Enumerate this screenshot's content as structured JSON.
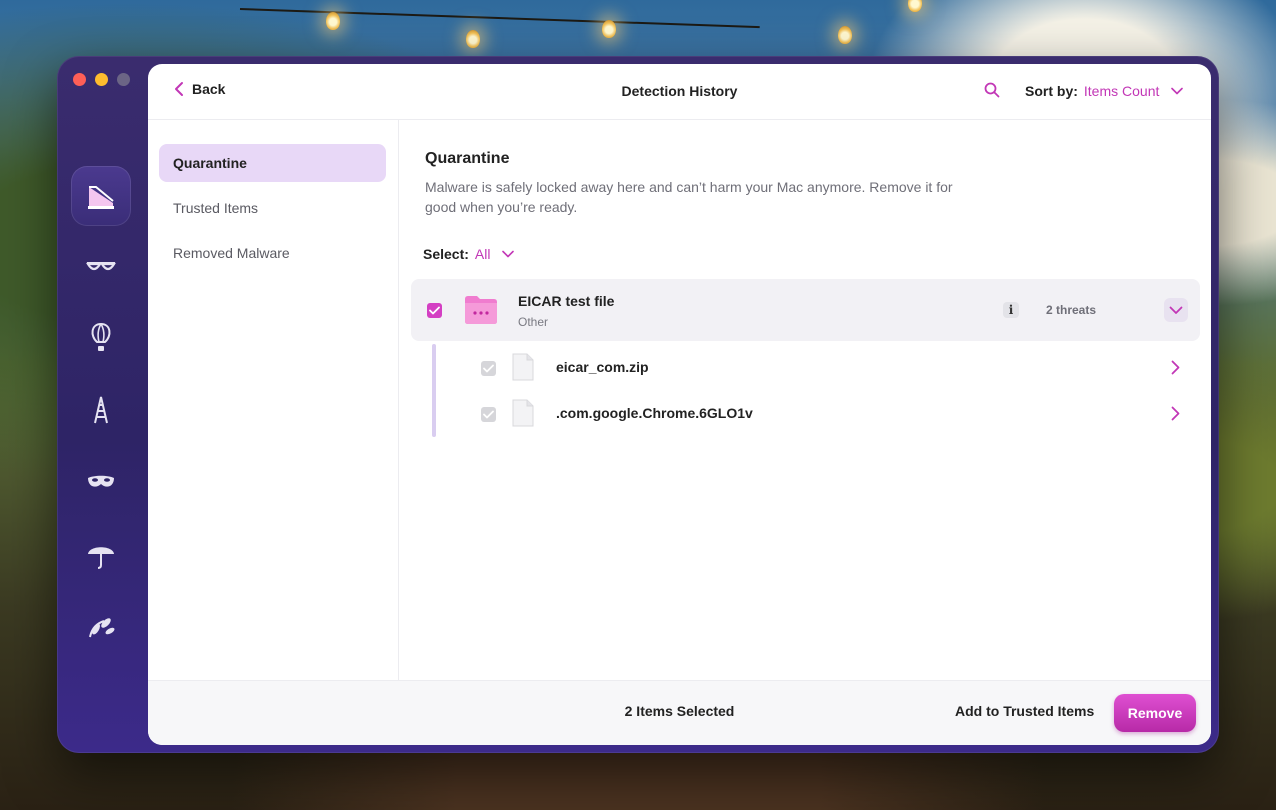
{
  "header": {
    "back_label": "Back",
    "title": "Detection History",
    "sort_label": "Sort by:",
    "sort_value": "Items Count"
  },
  "nav": {
    "items": [
      {
        "label": "Quarantine",
        "active": true
      },
      {
        "label": "Trusted Items",
        "active": false
      },
      {
        "label": "Removed Malware",
        "active": false
      }
    ]
  },
  "sidebar_icons": [
    "cleanup-icon",
    "glasses-icon",
    "balloon-icon",
    "ladder-icon",
    "mask-icon",
    "umbrella-icon",
    "leaves-icon"
  ],
  "content": {
    "heading": "Quarantine",
    "description": "Malware is safely locked away here and can’t harm your Mac anymore. Remove it for good when you’re ready.",
    "select_label": "Select:",
    "select_value": "All",
    "group": {
      "name": "EICAR test file",
      "category": "Other",
      "info_label": "i",
      "threats": "2 threats",
      "files": [
        {
          "name": "eicar_com.zip"
        },
        {
          "name": ".com.google.Chrome.6GLO1v"
        }
      ]
    }
  },
  "footer": {
    "selected_count": "2 Items Selected",
    "add_trusted_label": "Add to Trusted Items",
    "remove_label": "Remove"
  },
  "colors": {
    "accent": "#c237b6",
    "sidebar": "#2e2466",
    "nav_active": "#e8d8f7",
    "remove_button": "#d43fc3"
  }
}
